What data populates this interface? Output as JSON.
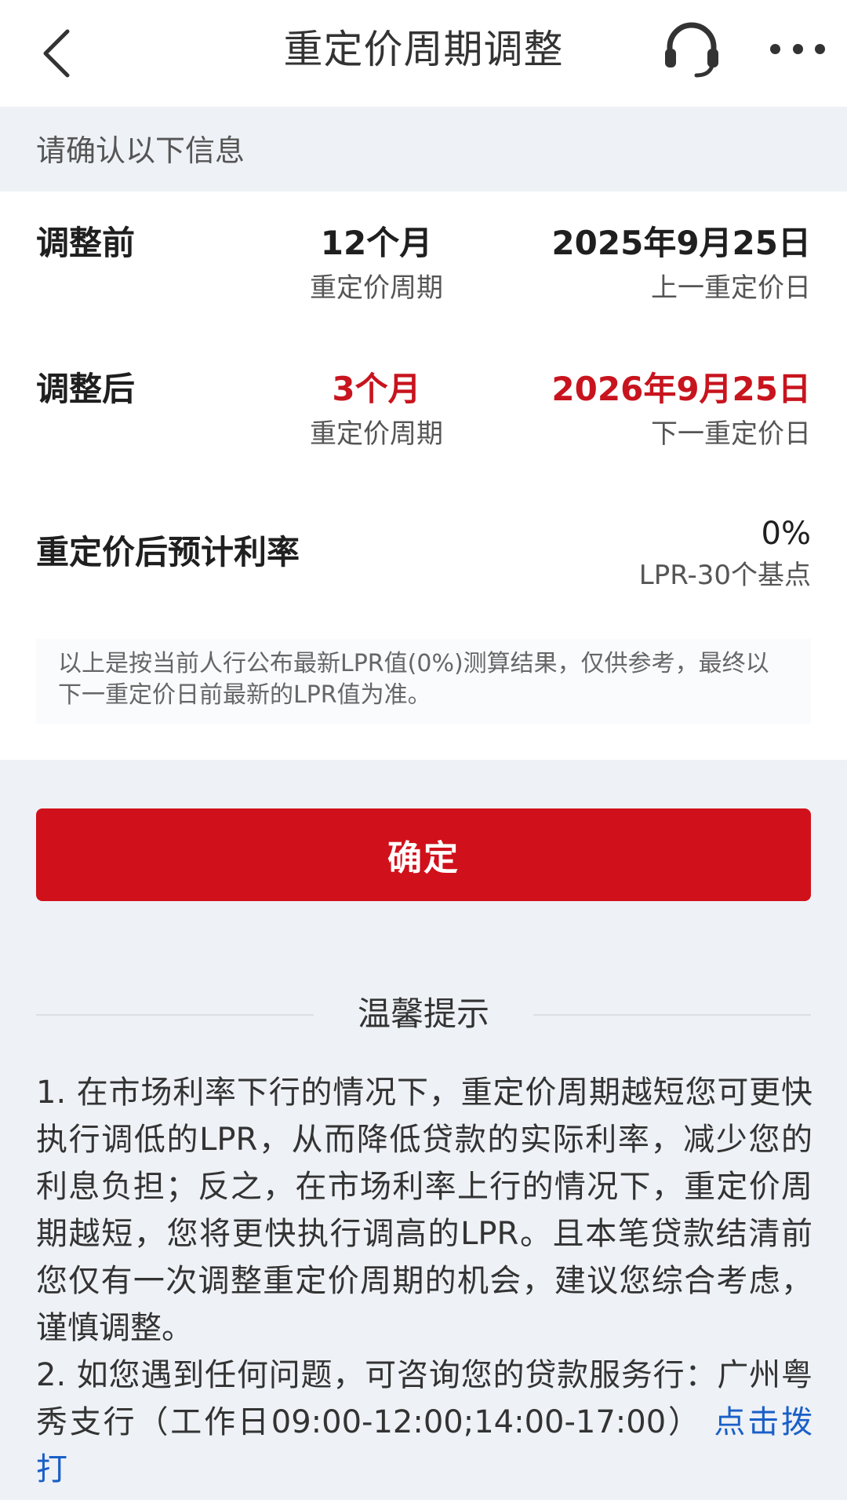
{
  "header": {
    "title": "重定价周期调整"
  },
  "section": {
    "heading": "请确认以下信息"
  },
  "before": {
    "label": "调整前",
    "period_value": "12个月",
    "period_caption": "重定价周期",
    "date_value": "2025年9月25日",
    "date_caption": "上一重定价日"
  },
  "after": {
    "label": "调整后",
    "period_value": "3个月",
    "period_caption": "重定价周期",
    "date_value": "2026年9月25日",
    "date_caption": "下一重定价日"
  },
  "rate": {
    "label": "重定价后预计利率",
    "value": "0%",
    "caption": "LPR-30个基点"
  },
  "note": "以上是按当前人行公布最新LPR值(0%)测算结果，仅供参考，最终以下一重定价日前最新的LPR值为准。",
  "confirm_label": "确定",
  "tips": {
    "title": "温馨提示",
    "item1": "1. 在市场利率下行的情况下，重定价周期越短您可更快执行调低的LPR，从而降低贷款的实际利率，减少您的利息负担；反之，在市场利率上行的情况下，重定价周期越短，您将更快执行调高的LPR。且本笔贷款结清前您仅有一次调整重定价周期的机会，建议您综合考虑，谨慎调整。",
    "item2": "2. 如您遇到任何问题，可咨询您的贷款服务行：广州粤秀支行（工作日09:00-12:00;14:00-17:00）",
    "call_link": "点击拨打"
  },
  "colors": {
    "accent_red": "#d0111b",
    "link_blue": "#1a5fc8"
  },
  "icons": {
    "back": "chevron-left-icon",
    "service": "headset-icon",
    "more": "more-dots-icon"
  }
}
